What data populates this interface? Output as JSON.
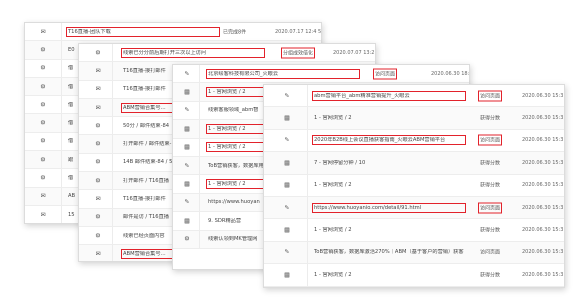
{
  "panel1": {
    "rows": [
      {
        "icon": "✉",
        "text": "T16直播-团队下载",
        "action": "已完成8件",
        "time": "2020.07.17 12:4 5"
      },
      {
        "icon": "⚙",
        "text": "E0",
        "action": "",
        "time": ""
      },
      {
        "icon": "⚙",
        "text": "借",
        "action": "",
        "time": ""
      },
      {
        "icon": "⚙",
        "text": "借",
        "action": "",
        "time": ""
      },
      {
        "icon": "⚙",
        "text": "借",
        "action": "",
        "time": ""
      },
      {
        "icon": "⚙",
        "text": "借",
        "action": "",
        "time": ""
      },
      {
        "icon": "⚙",
        "text": "借",
        "action": "",
        "time": ""
      },
      {
        "icon": "⚙",
        "text": "跟",
        "action": "",
        "time": ""
      },
      {
        "icon": "⚙",
        "text": "借",
        "action": "",
        "time": ""
      },
      {
        "icon": "✉",
        "text": "AB",
        "action": "",
        "time": ""
      },
      {
        "icon": "✉",
        "text": "15",
        "action": "",
        "time": ""
      }
    ]
  },
  "panel2": {
    "rows": [
      {
        "icon": "⚙",
        "text": "线索已分分前后期打开三次以上访问",
        "action": "分组成效倍化",
        "time": "2020.07.07 13:2 5"
      },
      {
        "icon": "✉",
        "text": "T16直播-接打邮件",
        "action": "",
        "time": ""
      },
      {
        "icon": "✉",
        "text": "T16直播-接打邮件",
        "action": "",
        "time": ""
      },
      {
        "icon": "✉",
        "text": "ABM营销合集号…",
        "action": "",
        "time": ""
      },
      {
        "icon": "⚙",
        "text": "50分 / 邮件结束-84",
        "action": "",
        "time": ""
      },
      {
        "icon": "⚙",
        "text": "打开邮件 / 邮件结束-",
        "action": "",
        "time": ""
      },
      {
        "icon": "⚙",
        "text": "14B 邮件结束-84 / 5",
        "action": "",
        "time": ""
      },
      {
        "icon": "⚙",
        "text": "打开邮件 / T16直播",
        "action": "",
        "time": ""
      },
      {
        "icon": "✉",
        "text": "T16直播-接打邮件",
        "action": "",
        "time": ""
      },
      {
        "icon": "⚙",
        "text": "邮件是访 / T16直播",
        "action": "",
        "time": ""
      },
      {
        "icon": "⚙",
        "text": "线索已经页面内容",
        "action": "",
        "time": ""
      },
      {
        "icon": "✉",
        "text": "ABM营销合集号…",
        "action": "",
        "time": ""
      }
    ]
  },
  "panel3": {
    "rows": [
      {
        "icon": "✎",
        "text": "北京绘客科技有限公司_火眼云",
        "action": "访问页面",
        "time": "2020.06.30 18:1 4"
      },
      {
        "icon": "▦",
        "text": "1 - 官网浏览 / 2",
        "action": "",
        "time": ""
      },
      {
        "icon": "✎",
        "text": "线索客服领域_abm智",
        "action": "",
        "time": ""
      },
      {
        "icon": "▦",
        "text": "1 - 官网浏览 / 2",
        "action": "",
        "time": ""
      },
      {
        "icon": "▦",
        "text": "1 - 官网浏览 / 2",
        "action": "",
        "time": ""
      },
      {
        "icon": "✎",
        "text": "ToB营销获客，数据库用户如何找出您的客户",
        "action": "",
        "time": ""
      },
      {
        "icon": "▦",
        "text": "1 - 官网浏览 / 2",
        "action": "",
        "time": ""
      },
      {
        "icon": "✎",
        "text": "https://www.huoyan",
        "action": "",
        "time": ""
      },
      {
        "icon": "▦",
        "text": "9. SDR精品营",
        "action": "",
        "time": ""
      },
      {
        "icon": "⚙",
        "text": "线索认领到MK管理网",
        "action": "",
        "time": ""
      }
    ]
  },
  "panel4": {
    "rows": [
      {
        "icon": "✎",
        "text": "abm营销平台_abm精准营销提升_火眼云",
        "action": "访问页面",
        "time": "2020.06.30 15:3 4"
      },
      {
        "icon": "▦",
        "text": "1 - 官网浏览 / 2",
        "action": "获得分数",
        "time": "2020.06.30 15:3 3"
      },
      {
        "icon": "✎",
        "text": "2020年B2B线上会议直播获客指南_火眼云ABM营销平台",
        "action": "访问页面",
        "time": "2020.06.30 15:3 3"
      },
      {
        "icon": "▦",
        "text": "7 - 官网停留分钟 / 10",
        "action": "获得分数",
        "time": "2020.06.30 15:3 3"
      },
      {
        "icon": "▦",
        "text": "1 - 官网浏览 / 2",
        "action": "获得分数",
        "time": "2020.06.30 15:3 3"
      },
      {
        "icon": "✎",
        "text": "https://www.huoyanio.com/detail/91.html",
        "action": "访问页面",
        "time": "2020.06.30 15:3 3"
      },
      {
        "icon": "▦",
        "text": "1 - 官网浏览 / 2",
        "action": "获得分数",
        "time": "2020.06.30 15:3 1"
      },
      {
        "icon": "✎",
        "text": "ToB营销获客，数据库激活270%｜ABM（基于客户的营销）获客白皮书_火眼云ABM营销平台",
        "action": "访问页面",
        "time": "2020.06.30 15:3 1"
      },
      {
        "icon": "▦",
        "text": "1 - 官网浏览 / 2",
        "action": "获得分数",
        "time": "2020.06.30 15:3 1"
      },
      {
        "icon": "✎",
        "text": "https://www.huoyanio.com/detail/96.html",
        "action": "访问页面",
        "time": "2020.06.30 15:3 1"
      }
    ]
  }
}
